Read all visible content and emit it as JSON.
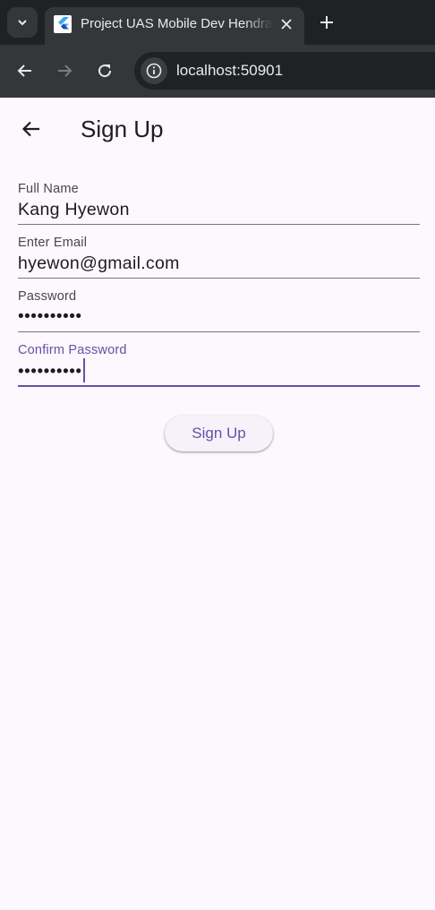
{
  "browser": {
    "tab_title": "Project UAS Mobile Dev Hendra",
    "url": "localhost:50901"
  },
  "appbar": {
    "title": "Sign Up"
  },
  "form": {
    "fields": [
      {
        "label": "Full Name",
        "value": "Kang Hyewon"
      },
      {
        "label": "Enter Email",
        "value": "hyewon@gmail.com"
      },
      {
        "label": "Password",
        "value": "••••••••••"
      },
      {
        "label": "Confirm Password",
        "value": "••••••••••"
      }
    ],
    "submit_label": "Sign Up"
  },
  "colors": {
    "accent": "#6750a4",
    "background": "#fdf7fe"
  }
}
